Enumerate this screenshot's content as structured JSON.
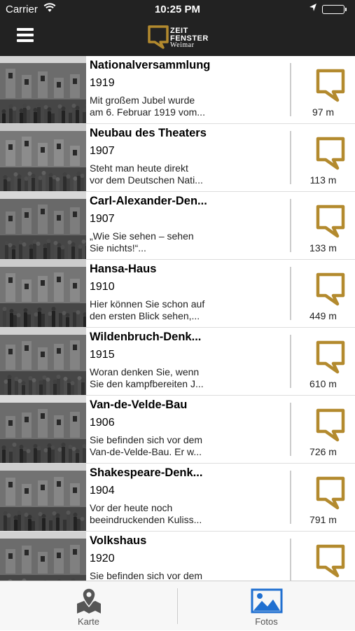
{
  "status_bar": {
    "carrier": "Carrier",
    "time": "10:25 PM"
  },
  "header": {
    "logo_line1": "ZEIT",
    "logo_line2": "FENSTER",
    "logo_line3": "Weimar"
  },
  "items": [
    {
      "title": "Nationalversammlung",
      "year": "1919",
      "desc_line1": "Mit großem Jubel wurde",
      "desc_line2": "am 6. Februar 1919 vom...",
      "distance": "97 m"
    },
    {
      "title": "Neubau des Theaters",
      "year": "1907",
      "desc_line1": "Steht man heute direkt",
      "desc_line2": "vor dem Deutschen Nati...",
      "distance": "113 m"
    },
    {
      "title": "Carl-Alexander-Den...",
      "year": "1907",
      "desc_line1": "„Wie Sie sehen – sehen",
      "desc_line2": "Sie nichts!“...",
      "distance": "133 m"
    },
    {
      "title": "Hansa-Haus",
      "year": "1910",
      "desc_line1": "Hier können Sie schon auf",
      "desc_line2": "den ersten Blick sehen,...",
      "distance": "449 m"
    },
    {
      "title": "Wildenbruch-Denk...",
      "year": "1915",
      "desc_line1": "Woran denken Sie, wenn",
      "desc_line2": "Sie den kampfbereiten J...",
      "distance": "610 m"
    },
    {
      "title": "Van-de-Velde-Bau",
      "year": "1906",
      "desc_line1": "Sie befinden sich vor dem",
      "desc_line2": "Van-de-Velde-Bau. Er w...",
      "distance": "726 m"
    },
    {
      "title": "Shakespeare-Denk...",
      "year": "1904",
      "desc_line1": "Vor der heute noch",
      "desc_line2": "beeindruckenden Kuliss...",
      "distance": "791 m"
    },
    {
      "title": "Volkshaus",
      "year": "1920",
      "desc_line1": "Sie befinden sich vor dem",
      "desc_line2": "",
      "distance": ""
    }
  ],
  "tabs": {
    "map_label": "Karte",
    "photos_label": "Fotos",
    "active": "Fotos",
    "active_color": "#1f6fd0",
    "inactive_color": "#555555"
  },
  "colors": {
    "accent_gold": "#b38a2e",
    "header_bg": "#222222"
  },
  "icons": {
    "menu": "hamburger-icon",
    "item_action": "speech-bubble-icon",
    "map_tab": "map-pin-icon",
    "photos_tab": "photos-icon"
  }
}
